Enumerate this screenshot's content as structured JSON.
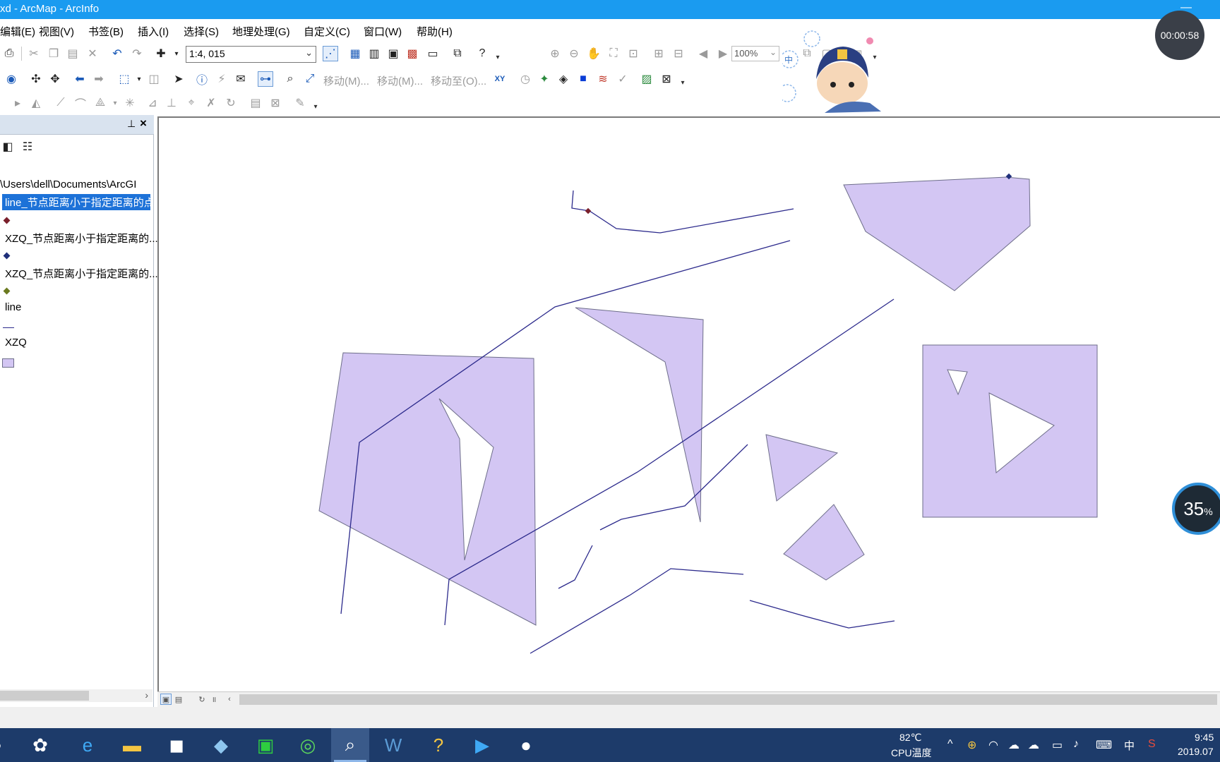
{
  "window": {
    "title": "xd - ArcMap - ArcInfo"
  },
  "menu": [
    "编辑(E)",
    "视图(V)",
    "书签(B)",
    "插入(I)",
    "选择(S)",
    "地理处理(G)",
    "自定义(C)",
    "窗口(W)",
    "帮助(H)"
  ],
  "toolbar": {
    "scale_value": "1:4, 015",
    "zoom_value": "100%",
    "move_1": "移动(M)...",
    "move_2": "移动(M)...",
    "move_to": "移动至(O)...",
    "xy_label": "XY"
  },
  "toc": {
    "path": "\\Users\\dell\\Documents\\ArcGI",
    "layers": [
      {
        "name": "line_节点距离小于指定距离的点",
        "selected": true,
        "symbol": "point",
        "color": "#7a1f2b"
      },
      {
        "name": "XZQ_节点距离小于指定距离的...",
        "selected": false,
        "symbol": "point",
        "color": "#1f2f7a"
      },
      {
        "name": "XZQ_节点距离小于指定距离的...",
        "selected": false,
        "symbol": "point",
        "color": "#6b7a1f"
      },
      {
        "name": "line",
        "selected": false,
        "symbol": "line",
        "color": "#2c2a8c"
      },
      {
        "name": "XZQ",
        "selected": false,
        "symbol": "polygon",
        "color": "#d3c6f3"
      }
    ]
  },
  "overlay": {
    "timer": "00:00:58",
    "cpu_percent": "35",
    "cpu_percent_sign": "%",
    "ime_label": "中"
  },
  "taskbar": {
    "cpu_temp": "82℃",
    "cpu_temp_label": "CPU温度",
    "ime": "中",
    "time": "9:45",
    "date": "2019.07"
  },
  "colors": {
    "titlebar": "#1a9bf0",
    "polygon_fill": "#d3c6f3",
    "polygon_stroke": "#6e6e8a",
    "line_stroke": "#2c2a8c",
    "selection": "#1d72d8",
    "taskbar": "#1d3b6a"
  }
}
